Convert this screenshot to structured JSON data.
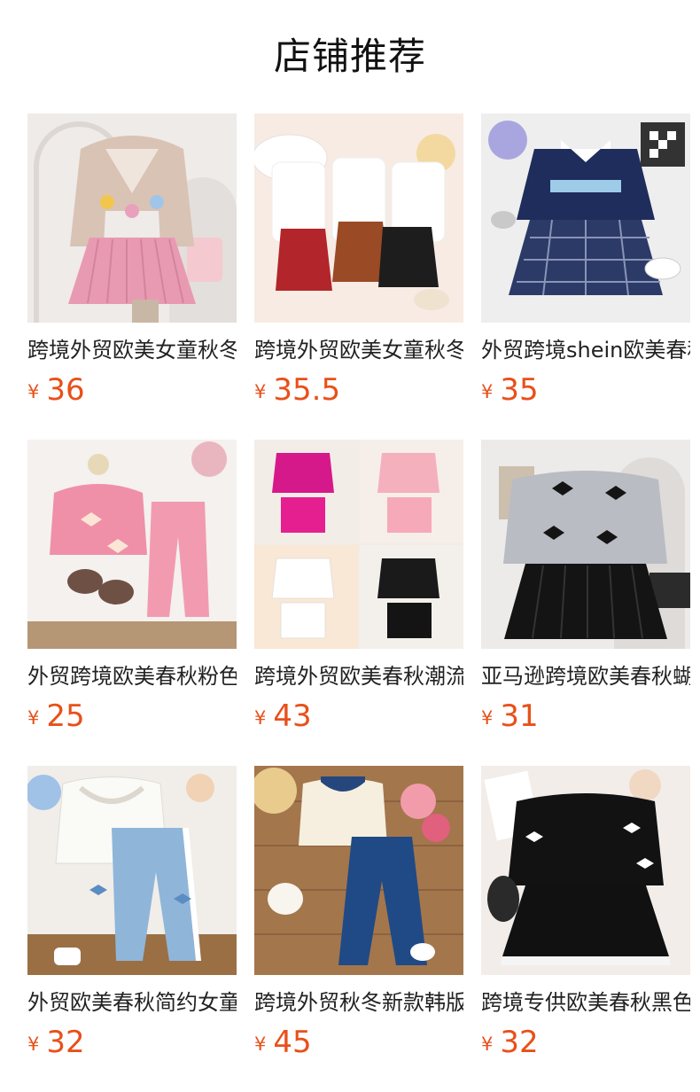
{
  "section": {
    "title": "店铺推荐"
  },
  "colors": {
    "price": "#e8501a",
    "title": "#222222"
  },
  "products": [
    {
      "title": "跨境外贸欧美女童秋冬新款针织开衫百褶裙套装",
      "currency": "¥",
      "price": "36",
      "image": "cardigan-pink-pleated-skirt-photo"
    },
    {
      "title": "跨境外贸欧美女童秋冬皮裙套装",
      "currency": "¥",
      "price": "35.5",
      "image": "white-top-leather-skirt-photo"
    },
    {
      "title": "外贸跨境shein欧美春秋学院风套装",
      "currency": "¥",
      "price": "35",
      "image": "brooklyn-sweatshirt-plaid-skirt-photo"
    },
    {
      "title": "外贸跨境欧美春秋粉色蝴蝶结套装",
      "currency": "¥",
      "price": "25",
      "image": "pink-bow-sweatshirt-set-photo"
    },
    {
      "title": "跨境外贸欧美春秋潮流西装短裙套装",
      "currency": "¥",
      "price": "43",
      "image": "blazer-skirt-four-colors-photo"
    },
    {
      "title": "亚马逊跨境欧美春秋蝴蝶结卫衣半身裙套装",
      "currency": "¥",
      "price": "31",
      "image": "grey-bow-sweatshirt-black-skirt-photo"
    },
    {
      "title": "外贸欧美春秋简约女童蝴蝶结阔腿裤套装",
      "currency": "¥",
      "price": "32",
      "image": "white-ruffle-top-blue-pants-photo"
    },
    {
      "title": "跨境外贸秋冬新款韩版牛仔阔腿裤套装",
      "currency": "¥",
      "price": "45",
      "image": "denim-collar-top-jeans-photo"
    },
    {
      "title": "跨境专供欧美春秋黑色蝴蝶结卫衣裙套装",
      "currency": "¥",
      "price": "32",
      "image": "black-bow-sweatshirt-skirt-photo"
    }
  ]
}
